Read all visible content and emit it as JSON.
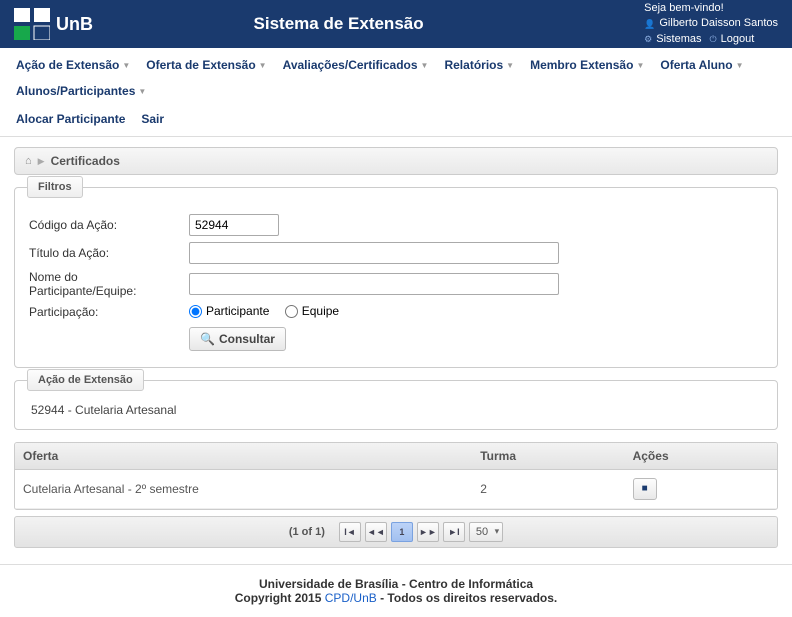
{
  "header": {
    "brand": "UnB",
    "title": "Sistema de Extensão",
    "welcome": "Seja bem-vindo!",
    "user_name": "Gilberto Daisson Santos",
    "link_sistemas": "Sistemas",
    "link_logout": "Logout"
  },
  "nav": {
    "items": [
      "Ação de Extensão",
      "Oferta de Extensão",
      "Avaliações/Certificados",
      "Relatórios",
      "Membro Extensão",
      "Oferta Aluno",
      "Alunos/Participantes"
    ],
    "items2": [
      "Alocar Participante",
      "Sair"
    ]
  },
  "breadcrumb": {
    "current": "Certificados"
  },
  "filters": {
    "legend": "Filtros",
    "label_codigo": "Código da Ação:",
    "value_codigo": "52944",
    "label_titulo": "Título da Ação:",
    "value_titulo": "",
    "label_nome": "Nome do Participante/Equipe:",
    "value_nome": "",
    "label_participacao": "Participação:",
    "radio_participante": "Participante",
    "radio_equipe": "Equipe",
    "btn_consultar": "Consultar"
  },
  "acao_box": {
    "legend": "Ação de Extensão",
    "text": "52944 - Cutelaria Artesanal"
  },
  "table": {
    "headers": {
      "oferta": "Oferta",
      "turma": "Turma",
      "acoes": "Ações"
    },
    "rows": [
      {
        "oferta": "Cutelaria Artesanal - 2º semestre",
        "turma": "2"
      }
    ]
  },
  "paginator": {
    "info": "(1 of 1)",
    "current_page": "1",
    "page_size": "50"
  },
  "footer": {
    "line1a": "Universidade de Brasília",
    "line1b": " - Centro de Informática",
    "copy_prefix": "Copyright 2015 ",
    "copy_link": "CPD/UnB",
    "copy_suffix": " - Todos os direitos reservados."
  }
}
